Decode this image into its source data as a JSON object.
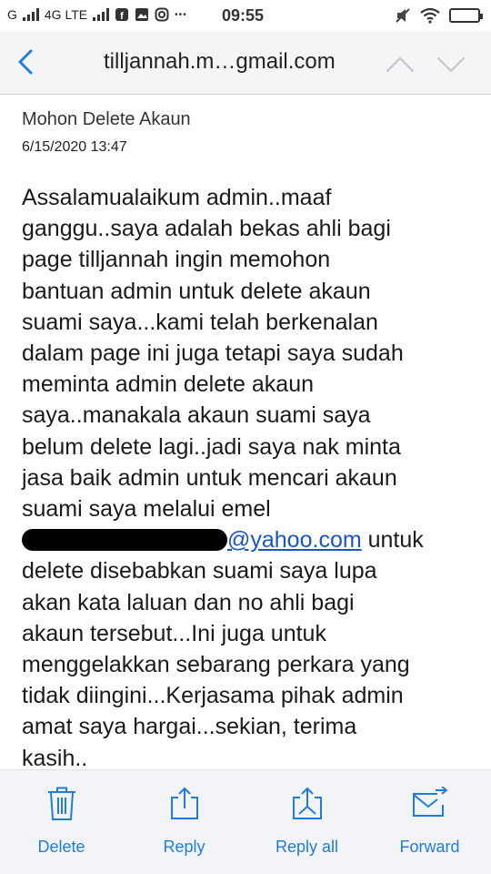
{
  "status_bar": {
    "network": "G",
    "network_type": "4G LTE",
    "time": "09:55",
    "icons": [
      "signal-icon",
      "signal-icon",
      "facebook-icon",
      "gallery-icon",
      "instagram-icon",
      "more-icon",
      "mute-icon",
      "wifi-icon",
      "battery-icon"
    ],
    "more": "•••"
  },
  "header": {
    "title": "tilljannah.m…gmail.com",
    "back_icon": "chevron-left-icon",
    "prev_icon": "chevron-up-icon",
    "next_icon": "chevron-down-icon"
  },
  "email": {
    "subject": "Mohon Delete Akaun",
    "date": "6/15/2020 13:47",
    "body_part1": "Assalamualaikum admin..maaf\nganggu..saya adalah bekas ahli bagi\npage tilljannah ingin memohon\nbantuan admin untuk delete akaun\nsuami saya...kami telah berkenalan\ndalam page ini juga tetapi saya sudah\nmeminta admin delete akaun\nsaya..manakala akaun suami saya\nbelum delete lagi..jadi saya nak minta\njasa baik admin untuk mencari akaun\nsuami saya melalui emel\n",
    "email_link": "@yahoo.com",
    "body_part2": " untuk\ndelete disebabkan suami saya lupa\nakan kata laluan dan no ahli bagi\nakaun tersebut...Ini juga untuk\nmenggelakkan sebarang perkara yang\ntidak diingini...Kerjasama pihak admin\namat saya hargai...sekian, terima\nkasih.."
  },
  "toolbar": {
    "delete": "Delete",
    "reply": "Reply",
    "reply_all": "Reply all",
    "forward": "Forward"
  },
  "colors": {
    "accent": "#1f7de0",
    "link": "#1b54c9",
    "header_bg": "#f5f5f7",
    "toolbar_bg": "#f3f4f8"
  }
}
